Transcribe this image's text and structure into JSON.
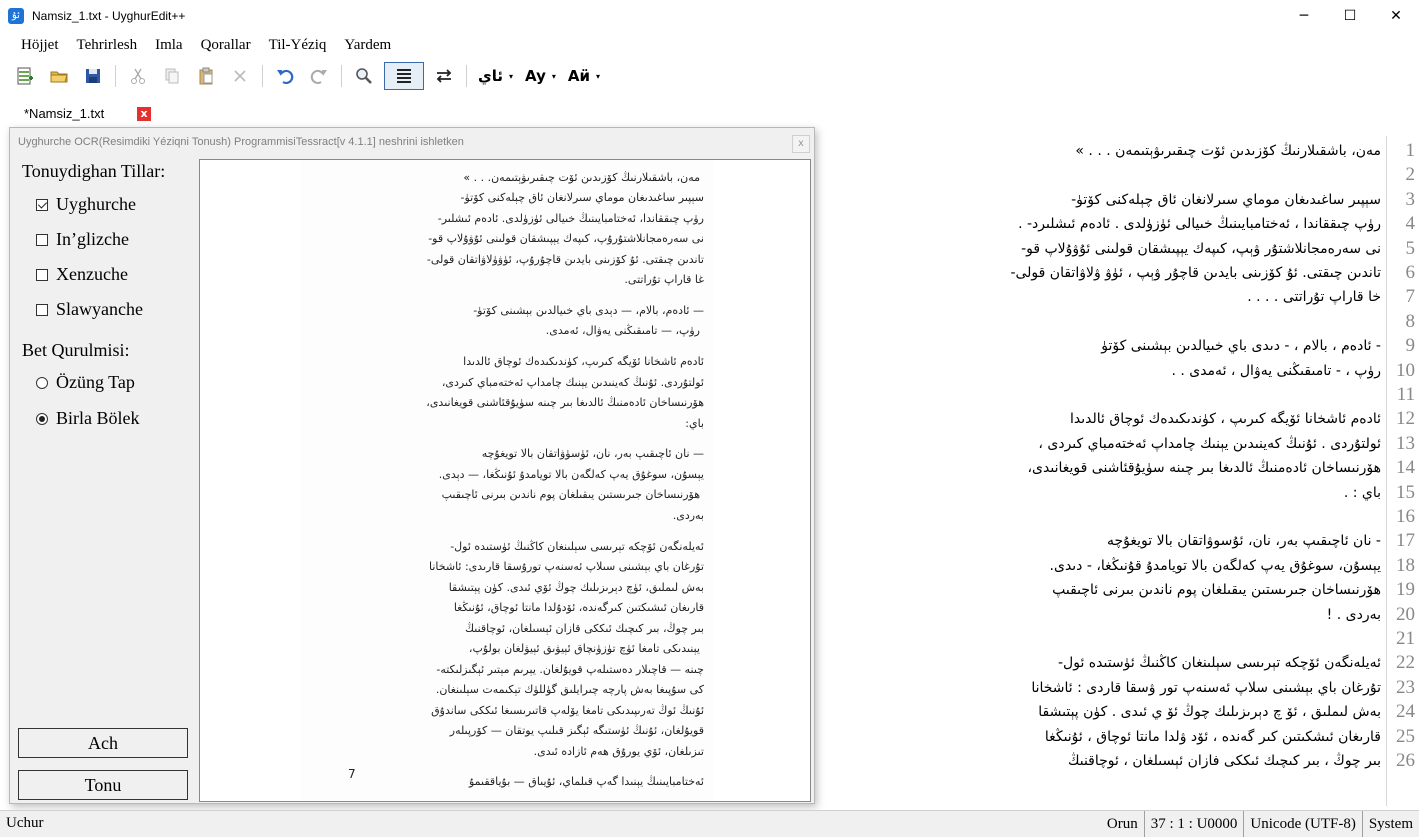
{
  "window": {
    "title": "Namsiz_1.txt - UyghurEdit++",
    "app_icon_glyph": "ئۇ",
    "minimize": "─",
    "maximize": "☐",
    "close": "✕"
  },
  "menu": [
    "Höjjet",
    "Tehrirlesh",
    "Imla",
    "Qorallar",
    "Til-Yéziq",
    "Yardem"
  ],
  "toolbar": {
    "font_button": "ئاي",
    "case_button": "Ay",
    "script_button": "Aӥ",
    "caret": "▾"
  },
  "tab": {
    "label": "*Namsiz_1.txt",
    "close": "x"
  },
  "dialog": {
    "title": "Uyghurche OCR(Resimdiki Yéziqni Tonush) ProgrammisiTessract[v 4.1.1] neshrini ishletken",
    "close": "x",
    "languages_label": "Tonuydighan Tillar:",
    "languages": [
      {
        "label": "Uyghurche",
        "checked": true
      },
      {
        "label": "In’glizche",
        "checked": false
      },
      {
        "label": "Xenzuche",
        "checked": false
      },
      {
        "label": "Slawyanche",
        "checked": false
      }
    ],
    "layout_label": "Bet Qurulmisi:",
    "layouts": [
      {
        "label": "Özüng Tap",
        "checked": false
      },
      {
        "label": "Birla Bölek",
        "checked": true
      }
    ],
    "open_button": "Ach",
    "recognize_button": "Tonu",
    "page_number": "7"
  },
  "editor": {
    "lines": [
      "مەن، باشقىلارنىڭ كۆزىدىن ئۆت چىقىرىۋېتىمەن . . . »",
      "",
      "سېپىر ساغىدىغان موماي سىرلانغان ئاق چېلەكنى كۆتۈ-",
      "رۈپ چىققاندا ، ئەختامبايىنىڭ خىيالى ئۈزۈلدى . ئادەم ئىشلىرد- .",
      "نى سەرەمجانلاشتۇر ۋېپ، كىپەك يېپىشقان قولىنى ئۇۋۇلاپ قو-",
      "تاندىن چىقتى. ئۇ كۆزىنى بايدىن قاچۇر ۋېپ ، ئۈۋ ۋلاۋاتقان قولى-",
      "خا قاراپ تۇراتتى . . . .",
      "",
      "- ئادەم ، بالام ، - دىدى باي خىيالدىن بېشىنى كۆتۈ",
      "رۈپ ، - تامىقىڭنى يەۋال ، ئەمدى . .",
      "",
      "ئادەم ئاشخانا ئۆيگە كىرىپ ، كۈندىكىدەك ئوچاق ئالدىدا",
      "ئولتۇردى . ئۇنىڭ كەينىدىن يېنىك چامداپ ئەختەمباي كىردى ،",
      "ھۆرنىساخان ئادەمنىڭ ئالدىغا بىر چىنە سۈيۇقئاشنى قويغانىدى،",
      "باي : .",
      "",
      "- نان ئاچىقىپ بەر، نان، ئۇسوۋاتقان بالا تويغۇچە",
      "يېسۇن، سوغۇق يەپ كەلگەن بالا تويامدۇ قۇنىڭغا، - دىدى.",
      "ھۆرنىساخان جىرىستىن يىقىلغان پوم ناندىن بىرنى ئاچىقىپ",
      "بەردى . !",
      "",
      "ئەيلەنگەن ئۆچكە تېرىسى سېلىنغان كاڭنىڭ ئۈستىدە ئول-",
      "تۇرغان باي بېشىنى سلاپ ئەسنەپ تور ۋسقا قاردى : ئاشخانا",
      "بەش لىملىق ، ئۆ چ دېرىزىلىك چوڭ ئۆ ي ئىدى . كۈن پېتىشقا",
      "قارىغان ئىشكىتىن كىر گەندە ، ئۆد ۋلدا مانتا ئوچاق ، ئۇنىڭغا",
      "بىر چوڭ ، بىر كىچىك ئىككى فازان ئېسىلغان ، ئوچاقنىڭ"
    ]
  },
  "ocr_page_lines": [
    "مەن، باشقىلارنىڭ كۆزىدىن ئۆت چىقىرىۋېتىمەن. . . »",
    "سېپىر ساغىدىغان موماي سىرلانغان ئاق چېلەكنى كۆتۈ-",
    "رۈپ چىققاندا، ئەختامبايىنىڭ خىيالى ئۈزۈلدى. ئادەم ئىشلىر-",
    "نى سەرەمجانلاشتۇرۇپ، كىپەك يېپىشقان قولىنى ئۇۋۇلاپ قو-",
    "تاندىن چىقتى. ئۇ كۆزىنى بايدىن قاچۇرۇپ، ئۈۋۈلاۋاتقان قولى-",
    "غا قاراپ تۇراتتى.",
    "— ئادەم، بالام، — دېدى باي خىيالدىن بېشىنى كۆتۈ-",
    "رۈپ، — تامىقىڭنى يەۋال، ئەمدى.",
    "ئادەم ئاشخانا ئۆيگە كىرىپ، كۈندىكىدەك ئوچاق ئالدىدا",
    "ئولتۇردى. ئۇنىڭ كەينىدىن يېنىك چامداپ ئەختەمباي كىردى،",
    "ھۆرنىساخان ئادەمنىڭ ئالدىغا بىر چىنە سۈيۇقئاشنى قويغانىدى،",
    "باي:",
    "— نان ئاچىقىپ بەر، نان، ئۈسۈۋاتقان بالا تويغۇچە",
    "يېسۇن، سوغۇق يەپ كەلگەن بالا تويامدۇ ئۇنىڭغا، — دېدى.",
    "ھۆرنىساخان جىرىستىن يىقىلغان پوم ناندىن بىرنى ئاچىقىپ",
    "بەردى.",
    "ئەيلەنگەن ئۆچكە تېرىسى سېلىنغان كاڭنىڭ ئۈستىدە ئول-",
    "تۇرغان باي بېشىنى سىلاپ ئەسنەپ تورۇسقا قارىدى: ئاشخانا",
    "بەش لىملىق، ئۈچ دېرىزىلىك چوڭ ئۆي ئىدى. كۈن پېتىشقا",
    "قارىغان ئىشىكتىن كىرگەندە، ئۆدۇلدا مانتا ئوچاق، ئۇنىڭغا",
    "بىر چوڭ، بىر كىچىك ئىككى قازان ئېسىلغان، ئوچاقنىڭ",
    "يېنىدىكى تامغا ئۈچ تۈزۈنچاق ئېيۋىق ئېيۋلغان بولۇپ،",
    "چىنە — قاچىلار دەستىلەپ قويۇلغان. يېرىم مېتىر ئېگىزلىكتە-",
    "كى سۇپىغا بەش پارچە چىرايلىق گۈللۈك تېكىمەت سېلىنغان.",
    "ئۇنىڭ ئوڭ تەرىپىدىكى تامغا يۆلەپ قاتىرىسىغا ئىككى ساندۇق",
    "قويۇلغان، ئۇنىڭ ئۈستىگە ئېگىز قىلىپ يوتقان — كۆرپىلەر",
    "تىزىلغان، ئۆي يورۇق ھەم ئازادە ئىدى.",
    "ئەختامبايىنىڭ يېنىدا گەپ قىلماي، ئۇيىاق — بۇياققىمۇ"
  ],
  "status": {
    "left": "Uchur",
    "mode": "Orun",
    "position": "37 : 1 : U0000",
    "encoding": "Unicode (UTF-8)",
    "font": "System"
  }
}
